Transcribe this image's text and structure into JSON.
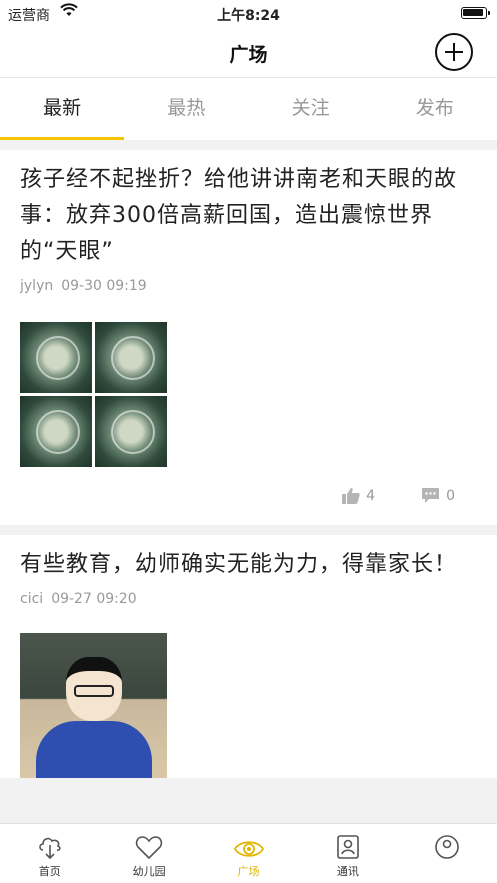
{
  "status_bar": {
    "carrier": "运营商",
    "time": "上午8:24"
  },
  "header": {
    "title": "广场",
    "add_icon": "plus-circle-icon"
  },
  "tabs": [
    {
      "label": "最新",
      "active": true
    },
    {
      "label": "最热",
      "active": false
    },
    {
      "label": "关注",
      "active": false
    },
    {
      "label": "发布",
      "active": false
    }
  ],
  "posts": [
    {
      "title": "孩子经不起挫折？给他讲讲南老和天眼的故事：放弃300倍高薪回国，造出震惊世界的“天眼”",
      "author": "jylyn",
      "date": "09-30 09:19",
      "likes": "4",
      "comments": "0"
    },
    {
      "title": "有些教育，幼师确实无能为力，得靠家长！",
      "author": "cici",
      "date": "09-27 09:20"
    }
  ],
  "tab_bar": [
    {
      "label": "首页",
      "icon": "home-cloud-icon",
      "active": false
    },
    {
      "label": "幼儿园",
      "icon": "heart-icon",
      "active": false
    },
    {
      "label": "广场",
      "icon": "eye-icon",
      "active": true
    },
    {
      "label": "通讯",
      "icon": "contacts-icon",
      "active": false
    },
    {
      "label": "",
      "icon": "profile-icon",
      "active": false
    }
  ],
  "colors": {
    "accent": "#f5c400",
    "accent_text": "#e3b500",
    "muted": "#999999"
  }
}
